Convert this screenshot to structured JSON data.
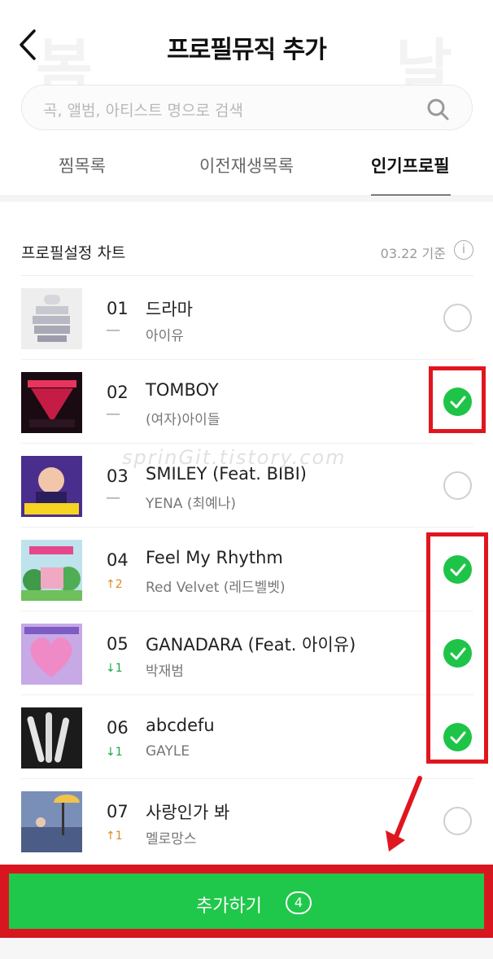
{
  "header": {
    "title": "프로필뮤직 추가",
    "watermark_left": "봄",
    "watermark_right": "날"
  },
  "search": {
    "placeholder": "곡, 앨범, 아티스트 명으로 검색"
  },
  "tabs": [
    {
      "label": "찜목록",
      "active": false
    },
    {
      "label": "이전재생목록",
      "active": false
    },
    {
      "label": "인기프로필",
      "active": true
    }
  ],
  "chart": {
    "title": "프로필설정 차트",
    "date": "03.22 기준",
    "info": "i"
  },
  "songs": [
    {
      "rank": "01",
      "trend": "—",
      "trend_dir": "same",
      "title": "드라마",
      "artist": "아이유",
      "checked": false
    },
    {
      "rank": "02",
      "trend": "—",
      "trend_dir": "same",
      "title": "TOMBOY",
      "artist": "(여자)아이들",
      "checked": true
    },
    {
      "rank": "03",
      "trend": "—",
      "trend_dir": "same",
      "title": "SMILEY (Feat. BIBI)",
      "artist": "YENA (최예나)",
      "checked": false
    },
    {
      "rank": "04",
      "trend": "↑2",
      "trend_dir": "up",
      "title": "Feel My Rhythm",
      "artist": "Red Velvet (레드벨벳)",
      "checked": true
    },
    {
      "rank": "05",
      "trend": "↓1",
      "trend_dir": "down",
      "title": "GANADARA (Feat. 아이유)",
      "artist": "박재범",
      "checked": true
    },
    {
      "rank": "06",
      "trend": "↓1",
      "trend_dir": "down",
      "title": "abcdefu",
      "artist": "GAYLE",
      "checked": true
    },
    {
      "rank": "07",
      "trend": "↑1",
      "trend_dir": "up",
      "title": "사랑인가 봐",
      "artist": "멜로망스",
      "checked": false
    }
  ],
  "overlay": {
    "watermark": "sprinGit.tistory.com"
  },
  "add_button": {
    "label": "추가하기",
    "count": "4"
  },
  "colors": {
    "accent_green": "#1fc84a",
    "highlight_red": "#e0161f",
    "trend_up": "#e08a1e",
    "trend_down": "#1aa84a"
  }
}
